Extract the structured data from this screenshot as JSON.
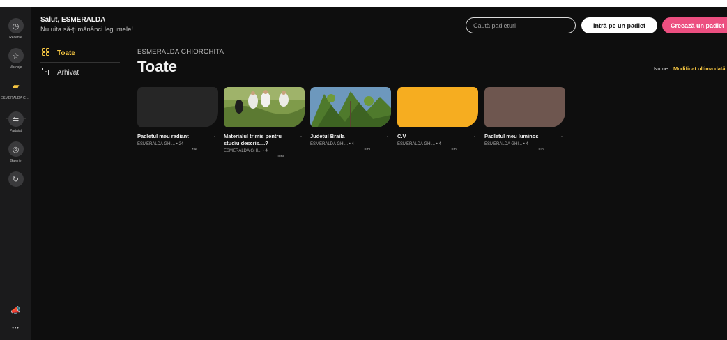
{
  "colors": {
    "background": "#0e0e0e",
    "rail": "#1b1b1c",
    "accent_yellow": "#f5c542",
    "create_pink": "#ec4f80"
  },
  "rail": {
    "items": [
      {
        "label": "Recente",
        "icon": "clock-icon"
      },
      {
        "label": "Marcaje",
        "icon": "star-icon"
      },
      {
        "label": "ESMERALDA GHIORGHITA",
        "icon": "folder-icon"
      },
      {
        "label": "Partajat",
        "icon": "share-icon"
      },
      {
        "label": "Galerie",
        "icon": "gallery-icon"
      },
      {
        "label": "",
        "icon": "add-icon"
      }
    ],
    "bottom": [
      {
        "icon": "megaphone-icon"
      },
      {
        "icon": "more-icon",
        "glyph": "•••"
      }
    ]
  },
  "header": {
    "greeting": "Salut, ESMERALDA",
    "subtitle": "Nu uita să-ți mănânci legumele!",
    "search_placeholder": "Caută padleturi",
    "join_label": "Intră pe un padlet",
    "create_label": "Creează un padlet"
  },
  "folders": {
    "items": [
      {
        "label": "Toate",
        "icon": "grid-icon",
        "active": true
      },
      {
        "label": "Arhivat",
        "icon": "archive-icon",
        "active": false
      }
    ]
  },
  "main": {
    "owner": "ESMERALDA GHIORGHITA",
    "title": "Toate",
    "sort_name": "Nume",
    "sort_modified": "Modificat ultima dată"
  },
  "cards": [
    {
      "title": "Padletul meu radiant",
      "author": "ESMERALDA GHI...",
      "age": "• 24",
      "age_unit": "zile",
      "thumb": "dark",
      "color": "#262626"
    },
    {
      "title": "Materialul trimis pentru studiu descris....?",
      "author": "ESMERALDA GHI...",
      "age": "• 4",
      "age_unit": "luni",
      "thumb": "photo-field",
      "color": "#6d8a3e"
    },
    {
      "title": "Judetul Braila",
      "author": "ESMERALDA GHI...",
      "age": "• 4",
      "age_unit": "luni",
      "thumb": "photo-tree",
      "color": "#4d7a9e"
    },
    {
      "title": "C.V",
      "author": "ESMERALDA GHI...",
      "age": "• 4",
      "age_unit": "luni",
      "thumb": "solid",
      "color": "#f6ad20"
    },
    {
      "title": "Padletul meu luminos",
      "author": "ESMERALDA GHI...",
      "age": "• 4",
      "age_unit": "luni",
      "thumb": "solid",
      "color": "#6e564f"
    }
  ]
}
